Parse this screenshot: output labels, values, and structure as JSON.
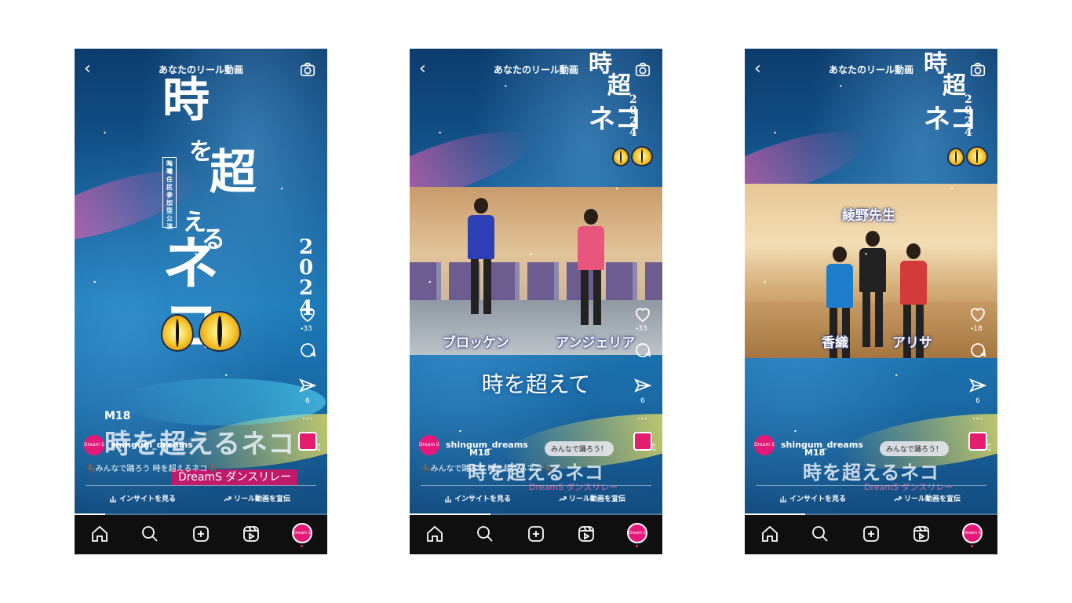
{
  "screens": [
    {
      "header": {
        "title": "あなたのリール動画"
      },
      "logo": {
        "c1": "時",
        "c2": "を",
        "c3": "超",
        "c4": "え",
        "c5": "る",
        "c6": "ネコ",
        "year": "2024",
        "sub": "晦曦住民参加型公演"
      },
      "sidebar": {
        "likes": "33",
        "shares": "6"
      },
      "overlay": {
        "m18": "M18",
        "big_title": "時を超えるネコ",
        "banner": "DreamS ダンスリレー"
      },
      "user": {
        "avatar": "Dream S",
        "username": "shingum_dreams"
      },
      "caption": "🐈‍⬛みんなで踊ろう 時を超えるネコ🐈‍⬛",
      "actions": {
        "insights": "インサイトを見る",
        "promote": "リール動画を宣伝"
      },
      "progress": 0.12
    },
    {
      "header": {
        "title": "あなたのリール動画"
      },
      "logo": {
        "c1": "時",
        "c3": "超",
        "c6": "ネコ",
        "year": "2024"
      },
      "names": {
        "left": "ブロッケン",
        "right": "アンジェリア"
      },
      "lyric": "時を超えて",
      "sidebar": {
        "likes": "33",
        "shares": "6"
      },
      "overlay": {
        "m18": "M18",
        "big_title": "時を超えるネコ",
        "banner": "DreamS ダンスリレー"
      },
      "user": {
        "avatar": "Dream S",
        "username": "shingum_dreams"
      },
      "pill": "みんなで踊ろう！",
      "caption": "🐈‍⬛みんなで踊ろう 時を超えるネコ🐈‍⬛",
      "actions": {
        "insights": "インサイトを見る",
        "promote": "リール動画を宣伝"
      },
      "progress": 0.32
    },
    {
      "header": {
        "title": "あなたのリール動画"
      },
      "logo": {
        "c1": "時",
        "c3": "超",
        "c6": "ネコ",
        "year": "2024"
      },
      "names": {
        "top": "綾野先生",
        "left": "香織",
        "right": "アリサ"
      },
      "sidebar": {
        "likes": "18",
        "shares": "6"
      },
      "overlay": {
        "m18": "M18",
        "big_title": "時を超えるネコ",
        "banner": "DreamS ダンスリレー"
      },
      "user": {
        "avatar": "Dream S",
        "username": "shingum_dreams"
      },
      "pill": "みんなで踊ろう！",
      "actions": {
        "insights": "インサイトを見る",
        "promote": "リール動画を宣伝"
      },
      "progress": 0.24
    }
  ],
  "colors": {
    "brand_pink": "#e5197a",
    "nav_bg": "#0f0f0f"
  },
  "icons": [
    "chevron-left-icon",
    "camera-icon",
    "heart-icon",
    "comment-icon",
    "send-icon",
    "more-icon",
    "music-note-icon",
    "insights-icon",
    "trend-arrow-icon",
    "home-icon",
    "search-icon",
    "add-icon",
    "reels-icon"
  ]
}
